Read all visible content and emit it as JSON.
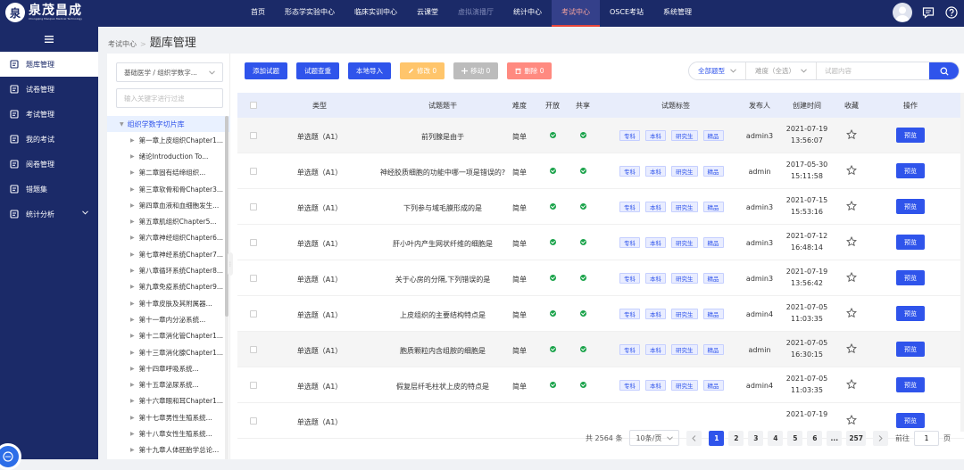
{
  "brand": {
    "name": "泉茂昌成",
    "subtitle": "Chongqing Maoqian Medical Technology",
    "accent": "#1b2a68"
  },
  "topnav": {
    "items": [
      "首页",
      "形态学实验中心",
      "临床实训中心",
      "云课堂",
      "虚拟演播厅",
      "统计中心",
      "考试中心",
      "OSCE考站",
      "系统管理"
    ],
    "active": "考试中心"
  },
  "sidebar": {
    "items": [
      {
        "label": "题库管理",
        "active": true
      },
      {
        "label": "试卷管理"
      },
      {
        "label": "考试管理"
      },
      {
        "label": "我的考试"
      },
      {
        "label": "阅卷管理"
      },
      {
        "label": "错题集"
      },
      {
        "label": "统计分析",
        "expandable": true
      }
    ]
  },
  "breadcrumb": {
    "parent": "考试中心",
    "separator": ">",
    "current": "题库管理"
  },
  "left": {
    "category": "基础医学 / 组织学数字...",
    "filter_placeholder": "输入关键字进行过滤",
    "tree_root": "组织学数字切片库",
    "tree_nodes": [
      "第一章上皮组织Chapter1...",
      "绪论Introduction To...",
      "第二章固有结缔组织...",
      "第三章软骨和骨Chapter3...",
      "第四章血液和血细胞发生...",
      "第五章肌组织Chapter5...",
      "第六章神经组织Chapter6...",
      "第七章神经系统Chapter7...",
      "第八章循环系统Chapter8...",
      "第九章免疫系统Chapter9...",
      "第十章皮肤及其附属器...",
      "第十一章内分泌系统...",
      "第十二章消化管Chapter1...",
      "第十三章消化腺Chapter1...",
      "第十四章呼吸系统...",
      "第十五章泌尿系统...",
      "第十六章眼和耳Chapter1...",
      "第十七章男性生殖系统...",
      "第十八章女性生殖系统...",
      "第十九章人体胚胎学总论..."
    ]
  },
  "toolbar": {
    "add": "添加试题",
    "check": "试题查重",
    "import": "本地导入",
    "edit": "修改 0",
    "move": "移动 0",
    "delete": "删除 0"
  },
  "filters": {
    "type": "全部题型",
    "difficulty": "难度（全选）",
    "search_placeholder": "试题内容"
  },
  "table": {
    "headers": {
      "type": "类型",
      "stem": "试题题干",
      "difficulty": "难度",
      "open": "开放",
      "share": "共享",
      "tags": "试题标签",
      "publisher": "发布人",
      "created": "创建时间",
      "fav": "收藏",
      "op": "操作"
    },
    "preview_label": "预览",
    "rows": [
      {
        "type": "单选题（A1）",
        "stem": "前列腺是由于",
        "difficulty": "简单",
        "tags": [
          "专科",
          "本科",
          "研究生",
          "精品"
        ],
        "publisher": "admin3",
        "date": "2021-07-19",
        "time": "13:56:07"
      },
      {
        "type": "单选题（A1）",
        "stem": "神经胶质细胞的功能中哪一项是错误的?",
        "difficulty": "简单",
        "tags": [
          "专科",
          "本科",
          "研究生",
          "精品"
        ],
        "publisher": "admin",
        "date": "2017-05-30",
        "time": "15:11:58"
      },
      {
        "type": "单选题（A1）",
        "stem": "下列参与域毛膜形成的是",
        "difficulty": "简单",
        "tags": [
          "专科",
          "本科",
          "研究生",
          "精品"
        ],
        "publisher": "admin3",
        "date": "2021-07-15",
        "time": "15:53:16"
      },
      {
        "type": "单选题（A1）",
        "stem": "肝小叶内产生网状纤维的细胞是",
        "difficulty": "简单",
        "tags": [
          "专科",
          "本科",
          "研究生",
          "精品"
        ],
        "publisher": "admin3",
        "date": "2021-07-12",
        "time": "16:48:14"
      },
      {
        "type": "单选题（A1）",
        "stem": "关于心房的分隔,下列错误的是",
        "difficulty": "简单",
        "tags": [
          "专科",
          "本科",
          "研究生",
          "精品"
        ],
        "publisher": "admin3",
        "date": "2021-07-19",
        "time": "13:56:42"
      },
      {
        "type": "单选题（A1）",
        "stem": "上皮组织的主要结构特点是",
        "difficulty": "简单",
        "tags": [
          "专科",
          "本科",
          "研究生",
          "精品"
        ],
        "publisher": "admin4",
        "date": "2021-07-05",
        "time": "11:03:35"
      },
      {
        "type": "单选题（A1）",
        "stem": "胞质颗粒内含组胺的细胞是",
        "difficulty": "简单",
        "tags": [
          "专科",
          "本科",
          "研究生",
          "精品"
        ],
        "publisher": "admin",
        "date": "2021-07-05",
        "time": "16:30:15"
      },
      {
        "type": "单选题（A1）",
        "stem": "假复层纤毛柱状上皮的特点是",
        "difficulty": "简单",
        "tags": [
          "专科",
          "本科",
          "研究生",
          "精品"
        ],
        "publisher": "admin4",
        "date": "2021-07-05",
        "time": "11:03:35"
      },
      {
        "type": "单选题（A1）",
        "stem": "",
        "difficulty": "",
        "tags": [],
        "publisher": "",
        "date": "2021-07-19",
        "time": ""
      }
    ]
  },
  "pagination": {
    "total": "共 2564 条",
    "page_size": "10条/页",
    "pages": [
      "1",
      "2",
      "3",
      "4",
      "5",
      "6",
      "...",
      "257"
    ],
    "current": "1",
    "goto_prefix": "前往",
    "goto_value": "1",
    "goto_suffix": "页"
  }
}
